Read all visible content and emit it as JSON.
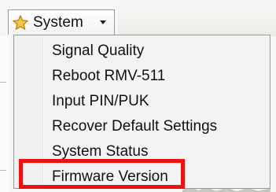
{
  "menu": {
    "title": "System",
    "items": [
      {
        "label": "Signal Quality"
      },
      {
        "label": "Reboot RMV-511"
      },
      {
        "label": "Input PIN/PUK"
      },
      {
        "label": "Recover Default Settings"
      },
      {
        "label": "System Status"
      },
      {
        "label": "Firmware Version"
      }
    ]
  },
  "icons": {
    "menu_icon": "star-icon",
    "dropdown_indicator": "chevron-down-icon"
  },
  "colors": {
    "highlight_border": "#ee1111",
    "star_fill": "#f2c64a",
    "star_stroke": "#b8860b"
  }
}
